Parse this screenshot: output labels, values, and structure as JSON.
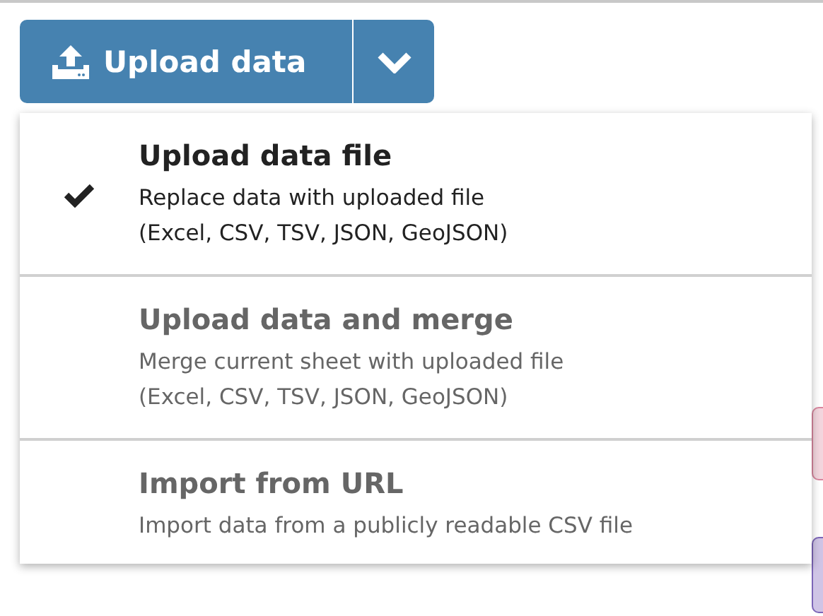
{
  "upload_button": {
    "label": "Upload data"
  },
  "menu": {
    "items": [
      {
        "title": "Upload data file",
        "description": "Replace data with uploaded file",
        "formats": "(Excel, CSV, TSV, JSON, GeoJSON)",
        "checked": true
      },
      {
        "title": "Upload data and merge",
        "description": "Merge current sheet with uploaded file",
        "formats": "(Excel, CSV, TSV, JSON, GeoJSON)",
        "checked": false
      },
      {
        "title": "Import from URL",
        "description": "Import data from a publicly readable CSV file",
        "checked": false
      }
    ]
  }
}
